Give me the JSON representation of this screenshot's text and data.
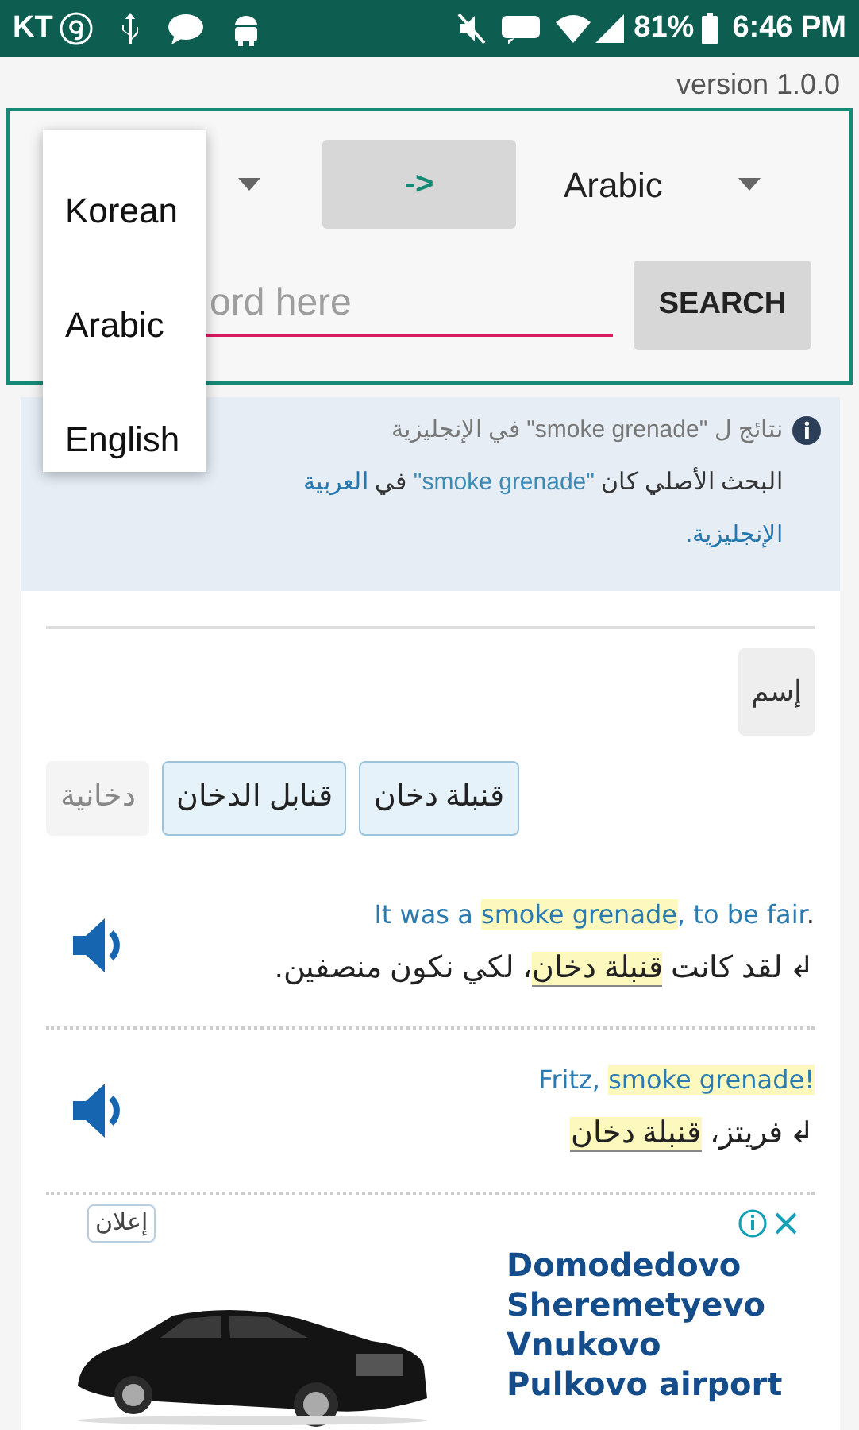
{
  "status_bar": {
    "carrier": "KT",
    "battery": "81%",
    "time": "6:46 PM"
  },
  "version": "version 1.0.0",
  "translator": {
    "source_language_menu": [
      {
        "label": "Korean"
      },
      {
        "label": "Arabic"
      },
      {
        "label": "English"
      }
    ],
    "swap_button": "->",
    "target_language": "Arabic",
    "search": {
      "placeholder": "ord here"
    },
    "search_button": "SEARCH"
  },
  "notice": {
    "lines": [
      [
        {
          "kind": "text",
          "text": "نتائج ل "
        },
        {
          "kind": "text",
          "text": "\"smoke grenade\""
        },
        {
          "kind": "text",
          "text": " في الإنجليزية"
        }
      ],
      [
        {
          "kind": "text",
          "text": "البحث الأصلي كان "
        },
        {
          "kind": "term",
          "text": "\"smoke grenade\""
        },
        {
          "kind": "text",
          "text": " في "
        },
        {
          "kind": "link",
          "text": "العربية"
        }
      ],
      [
        {
          "kind": "link",
          "text": "الإنجليزية."
        }
      ]
    ]
  },
  "entry": {
    "part_of_speech": "إسم",
    "translations": [
      {
        "text": "قنبلة دخان",
        "kind": "common"
      },
      {
        "text": "قنابل الدخان",
        "kind": "common"
      },
      {
        "text": "دخانية",
        "kind": "rare"
      }
    ],
    "examples": [
      {
        "source": {
          "before": "It was a ",
          "highlight": "smoke grenade",
          "after": ", to be fair",
          "end": "."
        },
        "arrow": "↲",
        "target": {
          "before": "لقد كانت ",
          "highlight": "قنبلة دخان",
          "after": "، لكي نكون منصفين."
        }
      },
      {
        "source": {
          "before": "Fritz, ",
          "highlight": "smoke grenade!"
        },
        "arrow": "↲",
        "target": {
          "before": "فريتز، ",
          "highlight": "قنبلة دخان"
        }
      }
    ]
  },
  "ad": {
    "tag": "إعلان",
    "lines": [
      "Domodedovo",
      "Sheremetyevo",
      "Vnukovo",
      "Pulkovo airport"
    ]
  }
}
